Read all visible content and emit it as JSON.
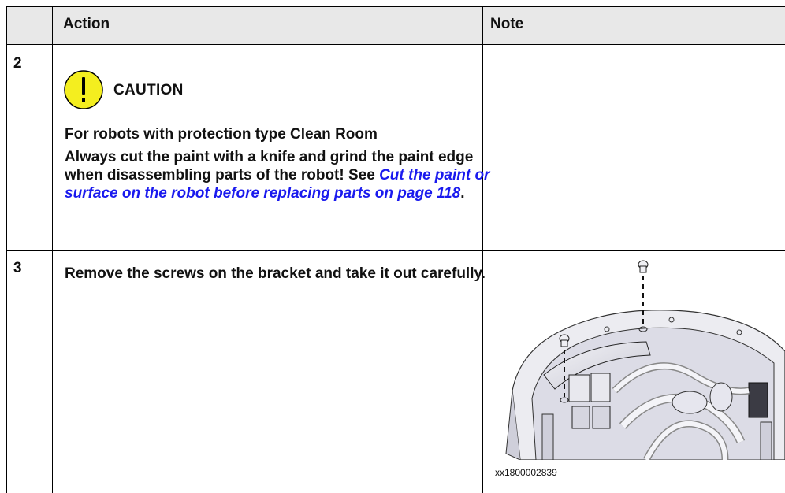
{
  "header": {
    "action_label": "Action",
    "note_label": "Note"
  },
  "steps": [
    {
      "number": "2",
      "caution_label": "CAUTION",
      "subheading": "For robots with protection type Clean Room",
      "text_before_link": "Always cut the paint with a knife and grind the paint edge when disassembling parts of the robot! See ",
      "link_text": "Cut the paint or surface on the robot before replacing parts on page 118",
      "text_after_link": "."
    },
    {
      "number": "3",
      "text": "Remove the screws on the bracket and take it out carefully.",
      "figure_caption": "xx1800002839"
    }
  ],
  "colors": {
    "header_bg": "#e8e8e8",
    "caution_yellow": "#f4ee1f",
    "link": "#1a1aee"
  }
}
